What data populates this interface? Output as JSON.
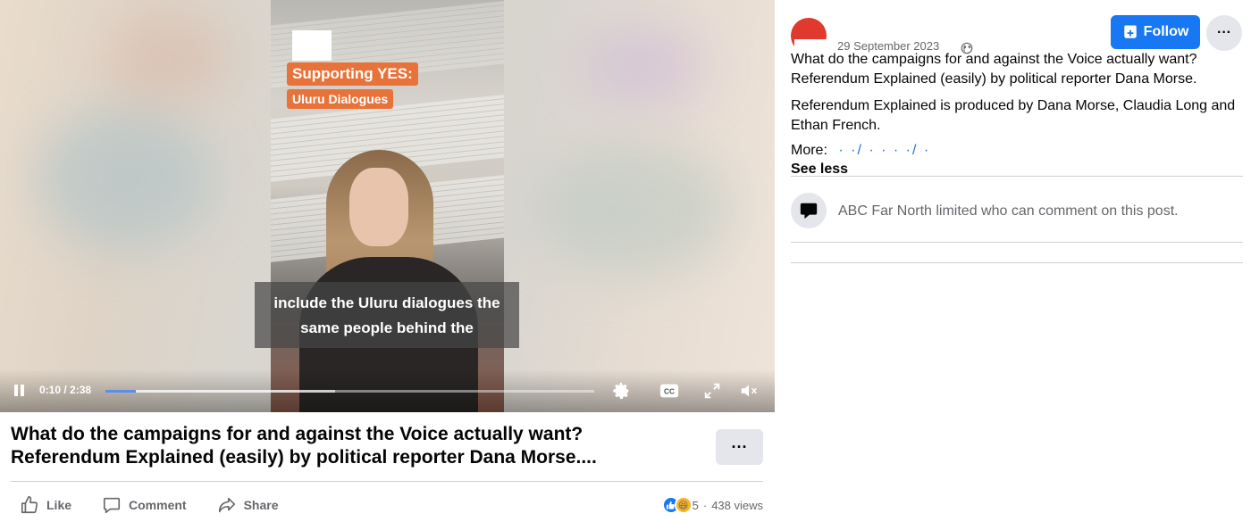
{
  "video": {
    "overlay_tag1": "Supporting YES:",
    "overlay_tag2": "Uluru Dialogues",
    "caption_line1": "include the Uluru dialogues the",
    "caption_line2": "same people behind the",
    "time_display": "0:10 / 2:38",
    "progress_played_fraction": 0.063,
    "progress_buffered_fraction": 0.47
  },
  "post": {
    "title_line1": "What do the campaigns for and against the Voice actually want?",
    "title_line2": "Referendum Explained (easily) by political reporter Dana Morse....",
    "more_button": "···"
  },
  "actions": {
    "like_label": "Like",
    "comment_label": "Comment",
    "share_label": "Share",
    "reaction_count": "5",
    "views": "438 views"
  },
  "sidebar": {
    "date": "29 September 2023",
    "follow_label": "Follow",
    "options_label": "···",
    "description_p1_line1": "What do the campaigns for and against the Voice actually want?",
    "description_p1_line2": "Referendum Explained (easily) by political reporter Dana Morse.",
    "description_p2": "Referendum Explained is produced by Dana Morse, Claudia Long and Ethan French.",
    "more_label": "More:",
    "see_less_label": "See less",
    "comment_notice": "ABC Far North limited who can comment on this post."
  },
  "colors": {
    "accent": "#1877f2",
    "tag_orange": "#e8733a",
    "muted_text": "#65676b",
    "button_gray": "#e4e6eb"
  }
}
